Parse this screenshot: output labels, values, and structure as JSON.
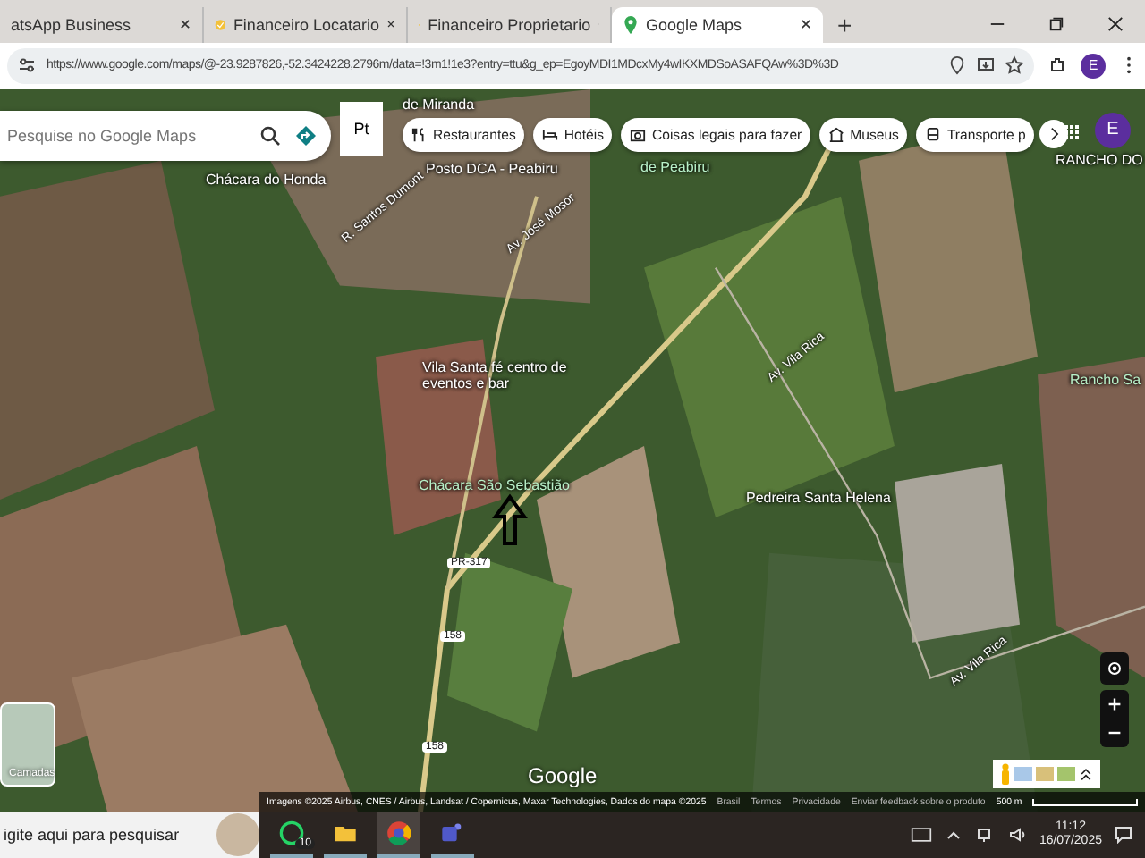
{
  "browser": {
    "tabs": [
      {
        "title": "atsApp Business",
        "kind": "whatsapp",
        "selected": false
      },
      {
        "title": "Financeiro Locatario",
        "kind": "finance",
        "selected": false
      },
      {
        "title": "Financeiro Proprietario",
        "kind": "finance",
        "selected": false
      },
      {
        "title": "Google Maps",
        "kind": "maps",
        "selected": true
      }
    ],
    "new_tab": "+",
    "url": "https://www.google.com/maps/@-23.9287826,-52.3424228,2796m/data=!3m1!1e3?entry=ttu&g_ep=EgoyMDI1MDcxMy4wIKXMDSoASAFQAw%3D%3D",
    "profile": "E"
  },
  "maps": {
    "search": {
      "placeholder": "Pesquise no Google Maps"
    },
    "layer_select": "Pt",
    "chips": [
      {
        "label": "Restaurantes",
        "kind": "fork"
      },
      {
        "label": "Hotéis",
        "kind": "bed"
      },
      {
        "label": "Coisas legais para fazer",
        "kind": "camera"
      },
      {
        "label": "Museus",
        "kind": "museum"
      },
      {
        "label": "Transporte p",
        "kind": "bus"
      }
    ],
    "account": "E",
    "labels": [
      {
        "text": "de Miranda",
        "kind": "place"
      },
      {
        "text": "Chácara do Honda",
        "kind": "place"
      },
      {
        "text": "Posto DCA - Peabiru",
        "kind": "place"
      },
      {
        "text": "de Peabiru",
        "kind": "green"
      },
      {
        "text": "RANCHO DO",
        "kind": "place"
      },
      {
        "text": "R. Santos Dumont",
        "kind": "street"
      },
      {
        "text": "Av. José Mosor",
        "kind": "street"
      },
      {
        "text": "Av. Vila Rica",
        "kind": "street"
      },
      {
        "text": "Vila Santa fé centro de eventos e bar",
        "kind": "place"
      },
      {
        "text": "Chácara São Sebastião",
        "kind": "green"
      },
      {
        "text": "Pedreira Santa Helena",
        "kind": "place"
      },
      {
        "text": "Rancho Sa",
        "kind": "green"
      },
      {
        "text": "PR-317",
        "kind": "shield"
      },
      {
        "text": "158",
        "kind": "shield"
      },
      {
        "text": "158",
        "kind": "shield"
      },
      {
        "text": "Av. Vila Rica",
        "kind": "street"
      }
    ],
    "layers_button": "Camadas",
    "google_logo": "Google",
    "attribution": "Imagens ©2025 Airbus, CNES / Airbus, Landsat / Copernicus, Maxar Technologies, Dados do mapa ©2025",
    "footer_links": [
      "Brasil",
      "Termos",
      "Privacidade",
      "Enviar feedback sobre o produto"
    ],
    "scale": "500 m"
  },
  "taskbar": {
    "search": "igite aqui para pesquisar",
    "apps": [
      {
        "kind": "whatsapp",
        "badge": "10",
        "selected": false
      },
      {
        "kind": "explorer",
        "selected": false
      },
      {
        "kind": "chrome",
        "selected": true
      },
      {
        "kind": "teams",
        "selected": false
      }
    ],
    "time": "11:12",
    "date": "16/07/2025"
  }
}
